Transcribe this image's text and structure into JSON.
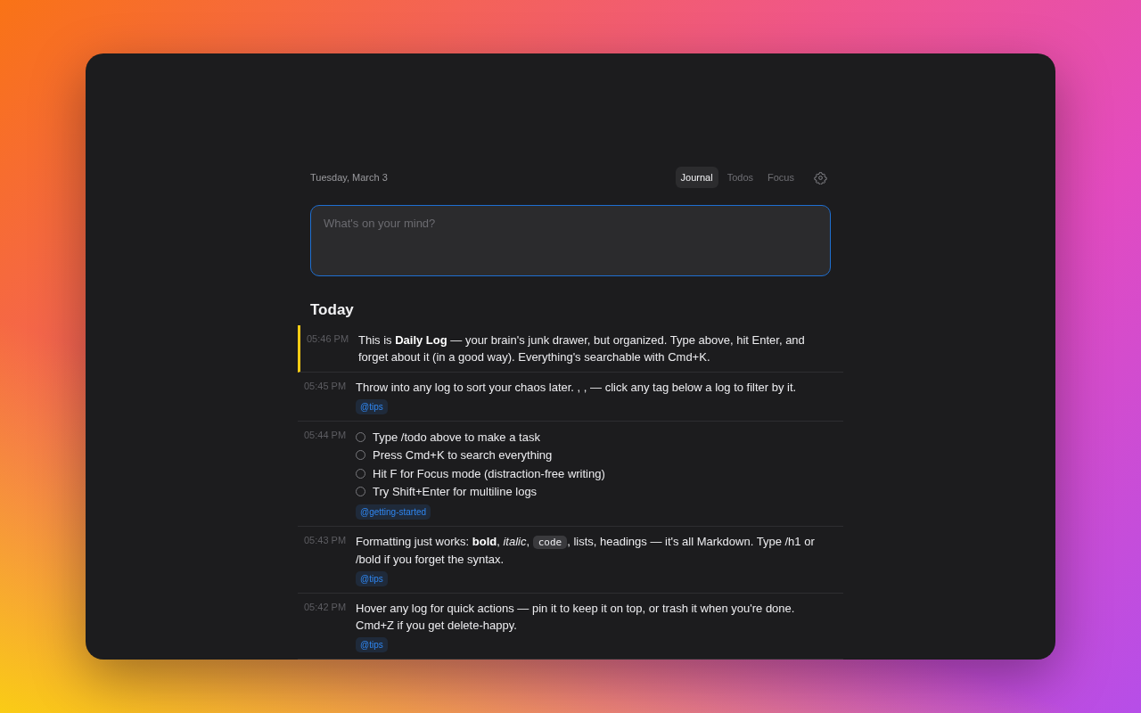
{
  "header": {
    "date": "Tuesday, March 3"
  },
  "tabs": [
    {
      "label": "Journal",
      "selected": true
    },
    {
      "label": "Todos",
      "selected": false
    },
    {
      "label": "Focus",
      "selected": false
    }
  ],
  "composer": {
    "placeholder": "What's on your mind?"
  },
  "section_title": "Today",
  "entries": [
    {
      "time": "05:46 PM",
      "pinned": true,
      "kind": "text",
      "segments": [
        {
          "kind": "text",
          "text": "This is **Daily Log** — your brain's junk drawer, but organized. Type above, hit Enter, and forget about it (in a good way). Everything's searchable with Cmd+K."
        }
      ]
    },
    {
      "time": "05:45 PM",
      "pinned": false,
      "kind": "text",
      "segments": [
        {
          "kind": "text",
          "text": "Throw into any log to sort your chaos later. , , — click any tag below a log to filter by it."
        }
      ],
      "tags": [
        "@tips"
      ]
    },
    {
      "time": "05:44 PM",
      "pinned": false,
      "kind": "todos",
      "todos": [
        {
          "text": "Type /todo above to make a task",
          "checked": false
        },
        {
          "text": "Press Cmd+K to search everything",
          "checked": false
        },
        {
          "text": "Hit F for Focus mode (distraction-free writing)",
          "checked": false
        },
        {
          "text": "Try Shift+Enter for multiline logs",
          "checked": false
        }
      ],
      "tags": [
        "@getting-started"
      ]
    },
    {
      "time": "05:43 PM",
      "pinned": false,
      "kind": "text",
      "segments": [
        {
          "kind": "text",
          "text": "Formatting just works: **bold**, *italic*, "
        },
        {
          "kind": "code",
          "text": "code"
        },
        {
          "kind": "text",
          "text": ", lists, headings — it's all Markdown. Type /h1 or /bold if you forget the syntax."
        }
      ],
      "tags": [
        "@tips"
      ]
    },
    {
      "time": "05:42 PM",
      "pinned": false,
      "kind": "text",
      "segments": [
        {
          "kind": "text",
          "text": "Hover any log for quick actions — pin it to keep it on top, or trash it when you're done. Cmd+Z if you get delete-happy."
        }
      ],
      "tags": [
        "@tips"
      ]
    }
  ]
}
